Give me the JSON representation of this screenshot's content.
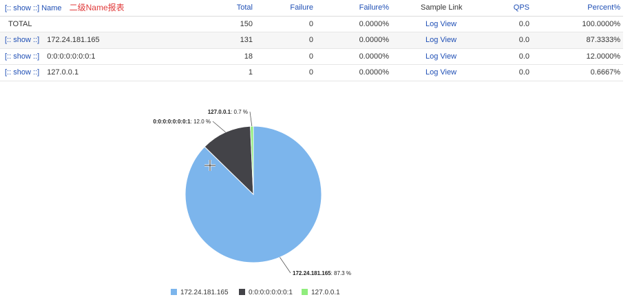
{
  "header": {
    "show_link": "[:: show ::]",
    "name": "Name",
    "annotation": "二级Name报表",
    "total": "Total",
    "failure": "Failure",
    "failure_pct": "Failure%",
    "sample_link": "Sample Link",
    "qps": "QPS",
    "percent": "Percent%"
  },
  "rows": [
    {
      "show": "",
      "name": "TOTAL",
      "total": "150",
      "failure": "0",
      "failure_pct": "0.0000%",
      "sample": "Log View",
      "qps": "0.0",
      "percent": "100.0000%"
    },
    {
      "show": "[:: show ::]",
      "name": "172.24.181.165",
      "total": "131",
      "failure": "0",
      "failure_pct": "0.0000%",
      "sample": "Log View",
      "qps": "0.0",
      "percent": "87.3333%"
    },
    {
      "show": "[:: show ::]",
      "name": "0:0:0:0:0:0:0:1",
      "total": "18",
      "failure": "0",
      "failure_pct": "0.0000%",
      "sample": "Log View",
      "qps": "0.0",
      "percent": "12.0000%"
    },
    {
      "show": "[:: show ::]",
      "name": "127.0.0.1",
      "total": "1",
      "failure": "0",
      "failure_pct": "0.0000%",
      "sample": "Log View",
      "qps": "0.0",
      "percent": "0.6667%"
    }
  ],
  "chart_data": {
    "type": "pie",
    "slices": [
      {
        "name": "172.24.181.165",
        "value": 87.3,
        "label": "87.3 %",
        "color": "#7cb5ec"
      },
      {
        "name": "0:0:0:0:0:0:0:1",
        "value": 12.0,
        "label": "12.0 %",
        "color": "#434348"
      },
      {
        "name": "127.0.0.1",
        "value": 0.7,
        "label": "0.7 %",
        "color": "#90ed7d"
      }
    ],
    "legend_position": "bottom-center"
  },
  "legend": [
    {
      "label": "172.24.181.165",
      "color": "#7cb5ec"
    },
    {
      "label": "0:0:0:0:0:0:0:1",
      "color": "#434348"
    },
    {
      "label": "127.0.0.1",
      "color": "#90ed7d"
    }
  ]
}
